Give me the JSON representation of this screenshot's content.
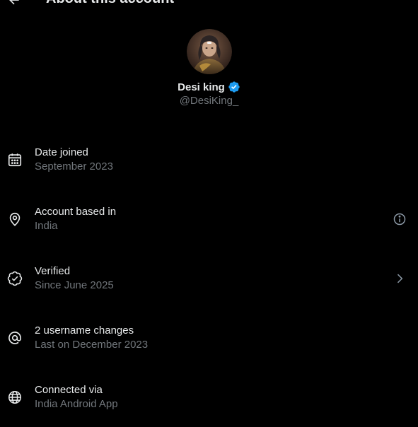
{
  "header": {
    "title": "About this account",
    "back_icon": "arrow-left-icon"
  },
  "profile": {
    "display_name": "Desi king",
    "handle": "@DesiKing_",
    "verified_badge_color": "#1d9bf0",
    "avatar_icon": "avatar-image"
  },
  "rows": [
    {
      "icon": "calendar-icon",
      "title": "Date joined",
      "subtitle": "September 2023"
    },
    {
      "icon": "location-pin-icon",
      "title": "Account based in",
      "subtitle": "India",
      "action_icon": "info-icon"
    },
    {
      "icon": "verified-badge-icon",
      "title": "Verified",
      "subtitle": "Since June 2025",
      "action_icon": "chevron-right-icon"
    },
    {
      "icon": "at-sign-icon",
      "title": "2 username changes",
      "subtitle": "Last on December 2023"
    },
    {
      "icon": "globe-icon",
      "title": "Connected via",
      "subtitle": "India Android App"
    }
  ],
  "colors": {
    "background": "#000000",
    "primary_text": "#e7e9ea",
    "secondary_text": "#71767b",
    "accent": "#1d9bf0"
  }
}
